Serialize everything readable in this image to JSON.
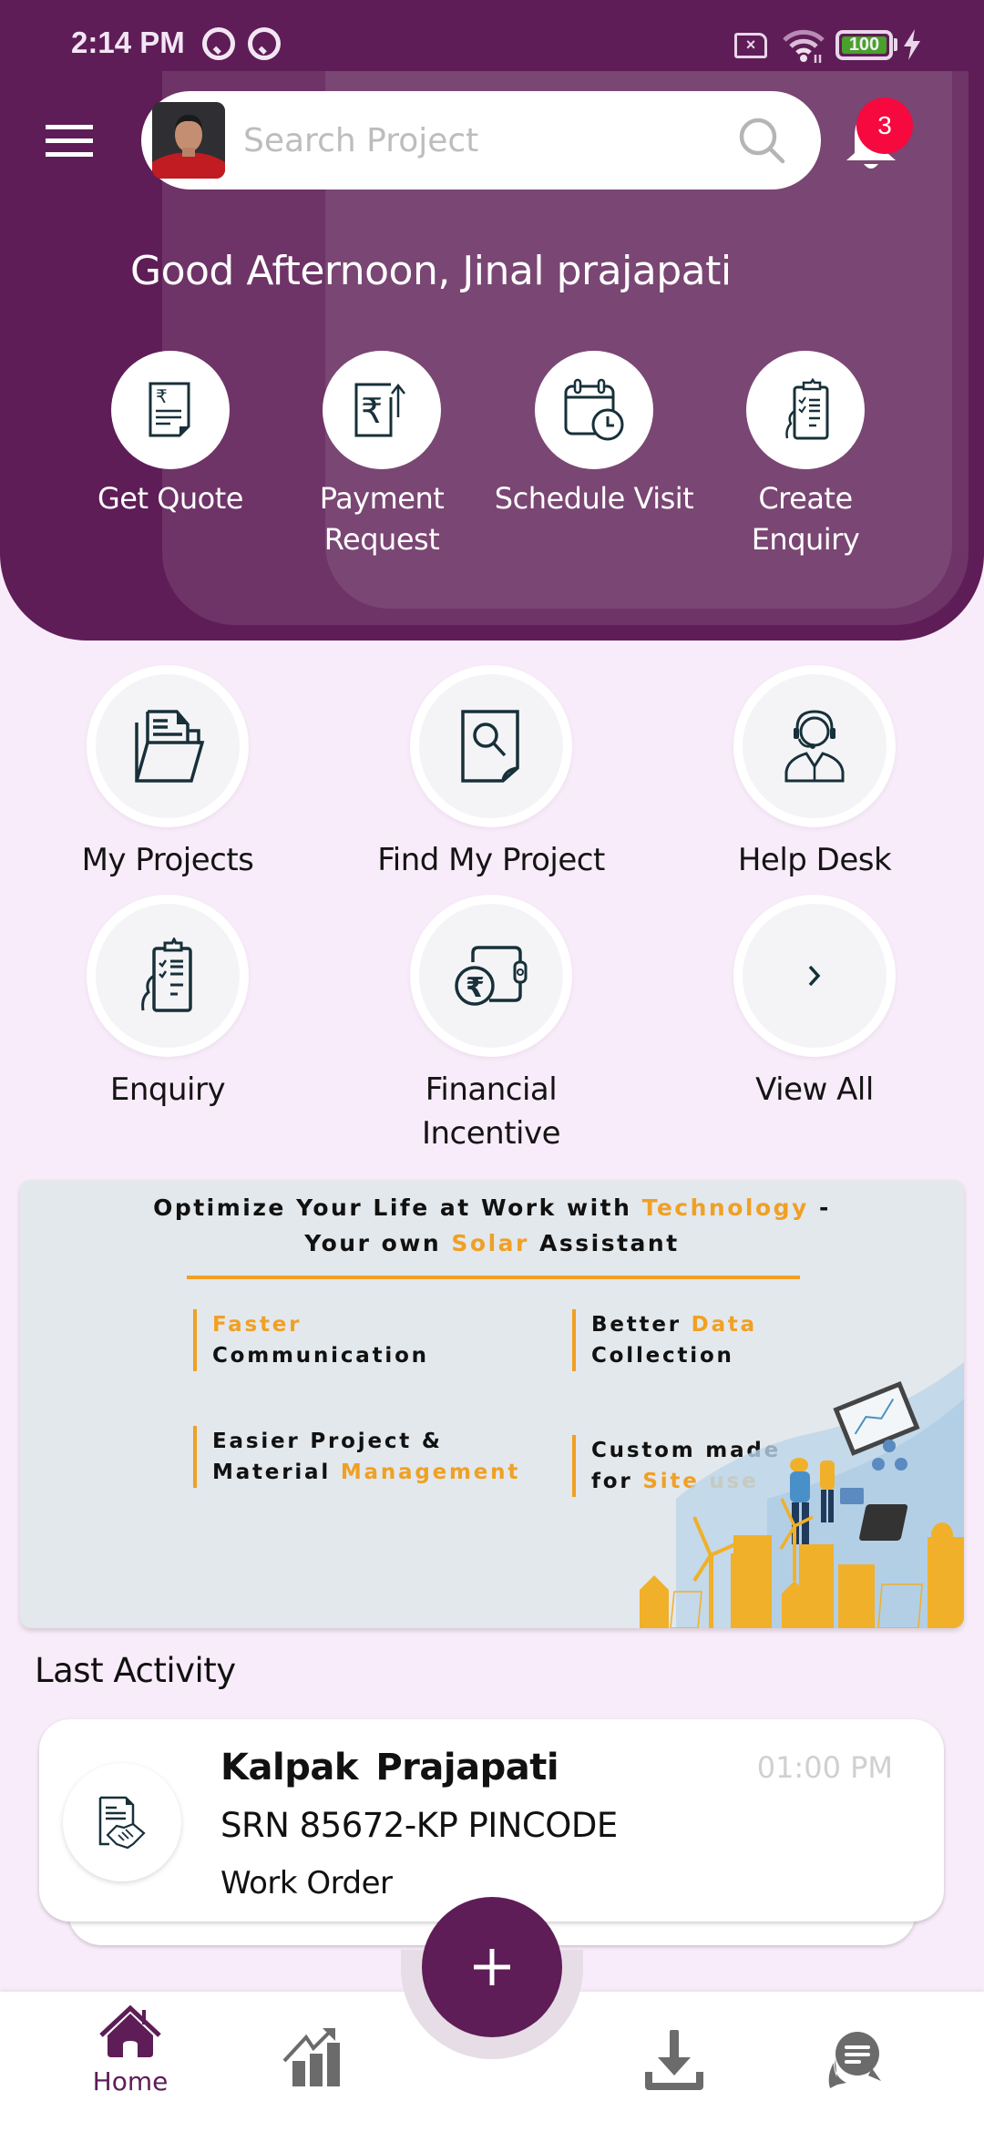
{
  "status_bar": {
    "time": "2:14 PM",
    "battery_level": "100",
    "icons": [
      "app-notification-icon",
      "app-notification-icon",
      "sim-missing-icon",
      "wifi-icon",
      "battery-icon",
      "charging-icon"
    ]
  },
  "header": {
    "search_placeholder": "Search Project",
    "notification_count": "3",
    "greeting": "Good Afternoon, Jinal prajapati",
    "quick_actions": [
      {
        "label_line1": "Get Quote",
        "label_line2": "",
        "icon": "quote-document-icon"
      },
      {
        "label_line1": "Payment",
        "label_line2": "Request",
        "icon": "payment-request-icon"
      },
      {
        "label_line1": "Schedule Visit",
        "label_line2": "",
        "icon": "calendar-clock-icon"
      },
      {
        "label_line1": "Create",
        "label_line2": "Enquiry",
        "icon": "clipboard-checklist-icon"
      }
    ]
  },
  "grid": {
    "items": [
      {
        "label_line1": "My Projects",
        "label_line2": "",
        "icon": "folder-icon"
      },
      {
        "label_line1": "Find My Project",
        "label_line2": "",
        "icon": "document-search-icon"
      },
      {
        "label_line1": "Help Desk",
        "label_line2": "",
        "icon": "support-agent-icon"
      },
      {
        "label_line1": "Enquiry",
        "label_line2": "",
        "icon": "clipboard-checklist-icon"
      },
      {
        "label_line1": "Financial",
        "label_line2": "Incentive",
        "icon": "wallet-rupee-icon"
      },
      {
        "label_line1": "View All",
        "label_line2": "",
        "icon": "chevron-right-icon"
      }
    ]
  },
  "banner": {
    "title_line1_a": "Optimize Your Life at Work with ",
    "title_line1_highlight": "Technology",
    "title_line1_b": " -",
    "title_line2_a": "Your own ",
    "title_line2_highlight": "Solar",
    "title_line2_b": " Assistant",
    "features": [
      {
        "line1_a": "",
        "line1_highlight": "Faster",
        "line2_a": "Communication",
        "line2_highlight": ""
      },
      {
        "line1_a": "Better ",
        "line1_highlight": "Data",
        "line2_a": "Collection",
        "line2_highlight": ""
      },
      {
        "line1_a": "Easier Project &",
        "line1_highlight": "",
        "line2_a": "Material ",
        "line2_highlight": "Management"
      },
      {
        "line1_a": "Custom made",
        "line1_highlight": "",
        "line2_a": "for ",
        "line2_highlight": "Site use"
      }
    ]
  },
  "last_activity": {
    "title": "Last Activity",
    "items": [
      {
        "name": "Kalpak  Prajapati",
        "time": "01:00 PM",
        "reference": "SRN 85672-KP PINCODE",
        "type": "Work Order",
        "icon": "handshake-document-icon"
      }
    ]
  },
  "bottom_nav": {
    "items": [
      {
        "label": "Home",
        "icon": "home-icon",
        "active": true
      },
      {
        "label": "",
        "icon": "analytics-chart-icon",
        "active": false
      },
      {
        "label": "",
        "icon": "download-icon",
        "active": false
      },
      {
        "label": "",
        "icon": "chat-icon",
        "active": false
      }
    ],
    "fab_icon": "plus-icon"
  },
  "colors": {
    "primary": "#5e1d57",
    "accent_orange": "#f0a024",
    "badge_red": "#f5093f",
    "background": "#f9ecfa",
    "icon_gray": "#6b6b6b"
  }
}
